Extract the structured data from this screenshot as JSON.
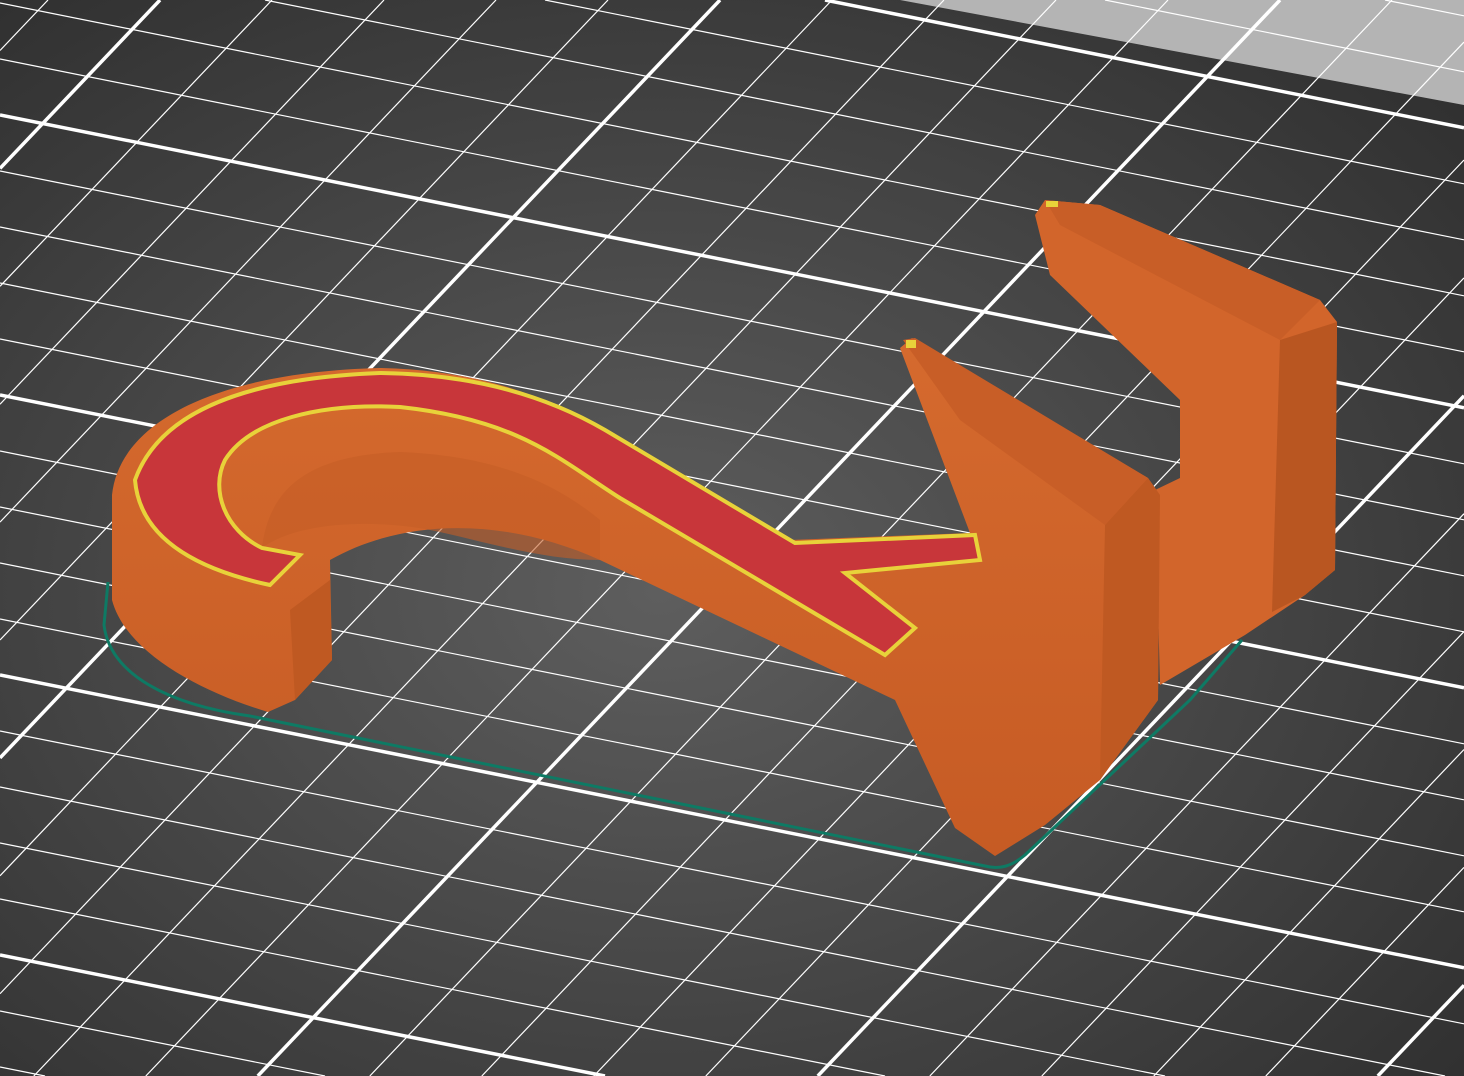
{
  "viewport": {
    "background_center": "#5e5e5e",
    "background_edge": "#2e2e2e",
    "bed_outside": "#b4b4b4",
    "grid_color": "#ffffff"
  },
  "model": {
    "perimeter_color": "#d2652b",
    "perimeter_shade": "#b95621",
    "infill_color": "#c8363a",
    "outline_color": "#e8d23a",
    "skirt_color": "#0e7a64"
  }
}
